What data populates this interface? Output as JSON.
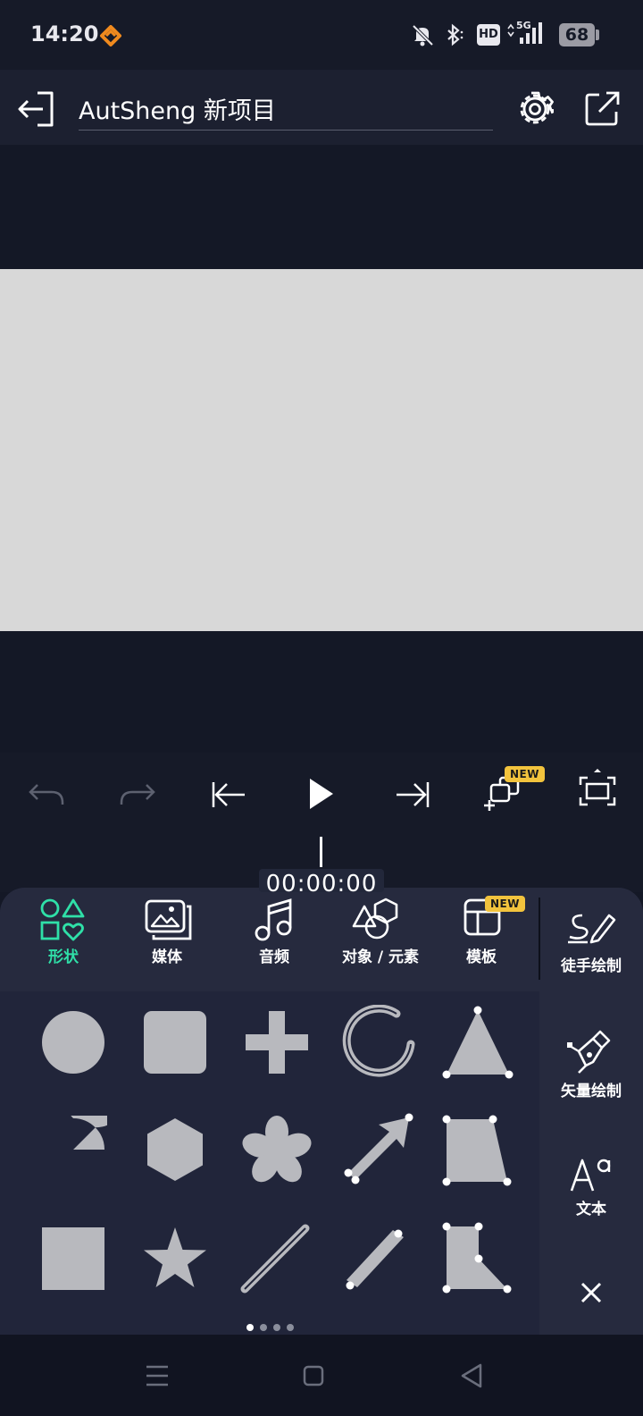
{
  "status_bar": {
    "time": "14:20",
    "hd_label": "HD",
    "network_label": "5G",
    "battery": "68"
  },
  "header": {
    "project_title": "AutSheng 新项目"
  },
  "playback": {
    "new_badge": "NEW",
    "timecode": "00:00:00"
  },
  "tabs": [
    {
      "label": "形状",
      "active": true
    },
    {
      "label": "媒体"
    },
    {
      "label": "音频"
    },
    {
      "label": "对象 / 元素"
    },
    {
      "label": "模板",
      "badge": "NEW"
    }
  ],
  "side_tools": [
    {
      "label": "徒手绘制",
      "icon": "freehand-pen-icon"
    },
    {
      "label": "矢量绘制",
      "icon": "vector-pen-icon"
    },
    {
      "label": "文本",
      "icon": "text-icon"
    }
  ],
  "shapes": [
    "circle",
    "rounded-square",
    "plus",
    "arc-ring",
    "triangle",
    "pie",
    "hexagon",
    "flower",
    "arrow",
    "trapezoid",
    "square",
    "star",
    "line",
    "thick-line",
    "l-shape"
  ],
  "colors": {
    "accent": "#2fe0a8",
    "badge": "#f2c33d",
    "shape_fill": "#b8b9be",
    "status_orange": "#f08a1e"
  },
  "page_indicator": {
    "count": 4,
    "active": 0
  }
}
